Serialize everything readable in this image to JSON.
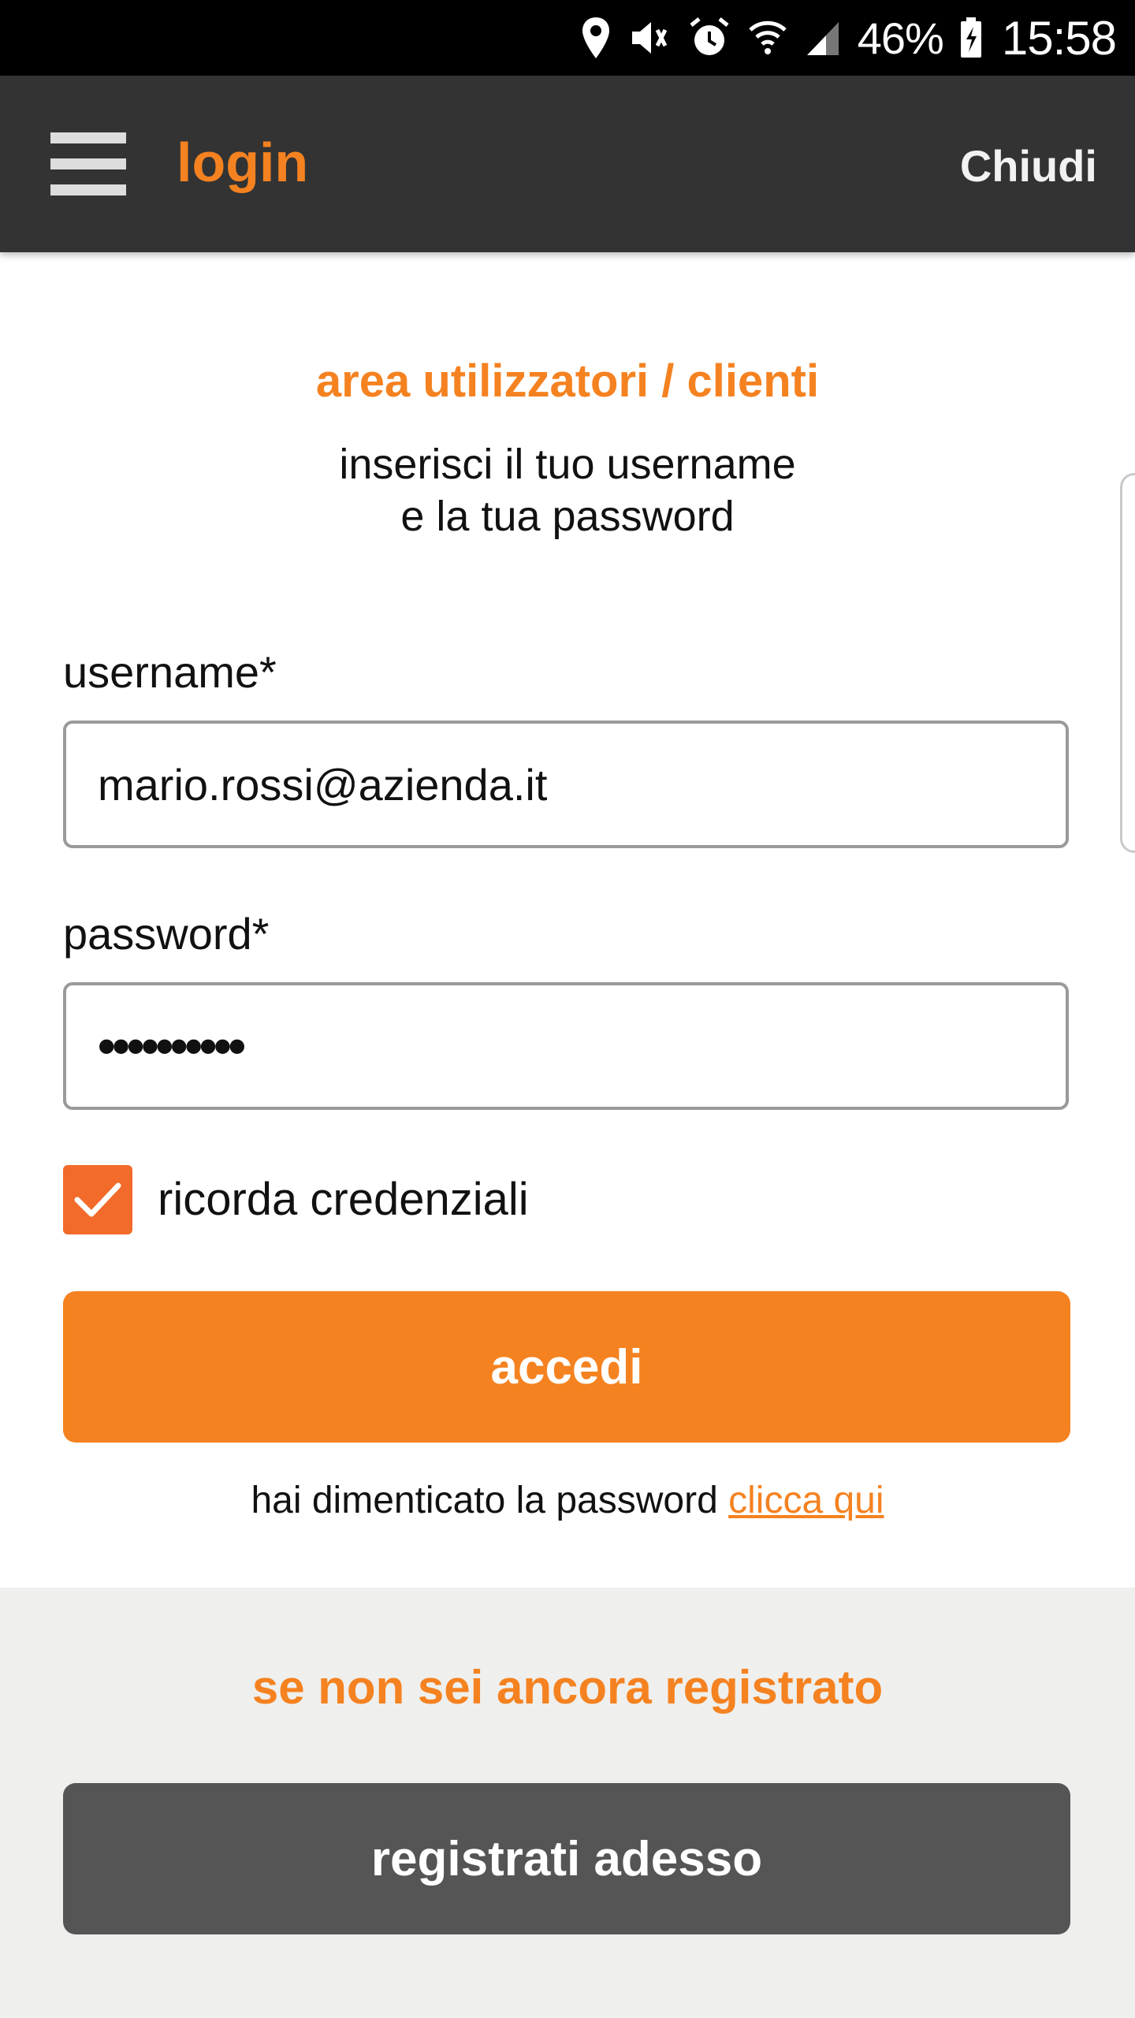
{
  "status_bar": {
    "battery": "46%",
    "time": "15:58",
    "icons": [
      "location-icon",
      "vibrate-icon",
      "alarm-icon",
      "wifi-icon",
      "signal-icon",
      "battery-charging-icon"
    ]
  },
  "app_bar": {
    "menu_icon": "hamburger-menu-icon",
    "title": "login",
    "close_label": "Chiudi"
  },
  "login": {
    "title": "area utilizzatori / clienti",
    "instructions_line1": "inserisci il tuo username",
    "instructions_line2": "e la tua password",
    "username_label": "username*",
    "username_value": "mario.rossi@azienda.it",
    "password_label": "password*",
    "password_value": "••••••••••",
    "remember_label": "ricorda credenziali",
    "remember_checked": true,
    "submit_label": "accedi",
    "forgot_text": "hai dimenticato la password",
    "forgot_link": "clicca qui"
  },
  "register": {
    "title": "se non sei ancora registrato",
    "button_label": "registrati adesso"
  },
  "colors": {
    "accent": "#f58220",
    "checkbox": "#f26b2a",
    "app_bar": "#333333",
    "register_button": "#555555",
    "register_background": "#efefed"
  }
}
